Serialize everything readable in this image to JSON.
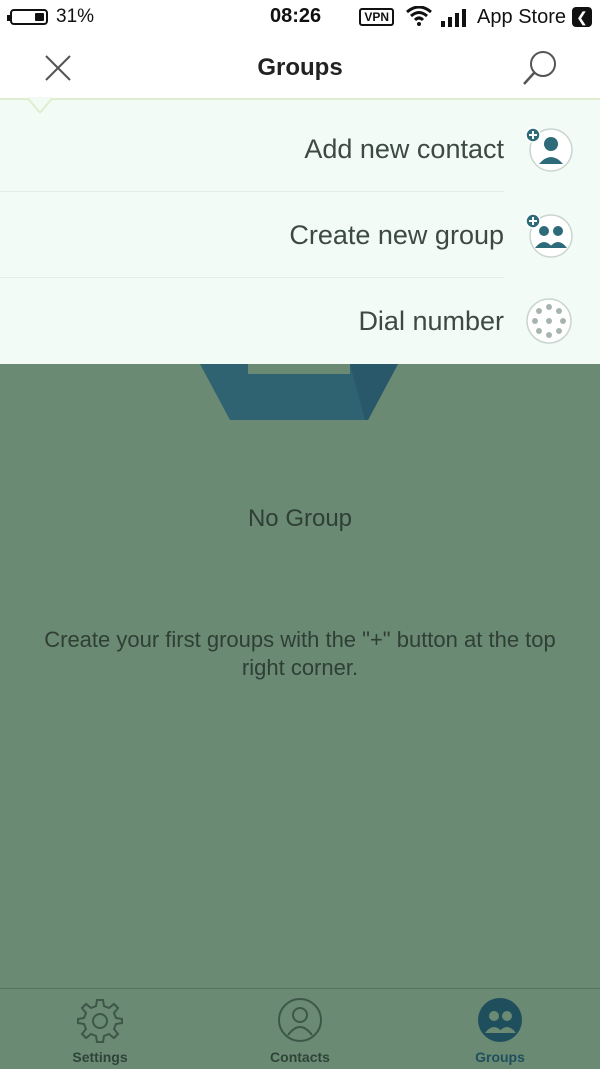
{
  "status_bar": {
    "back_app": "App Store",
    "vpn": "VPN",
    "time": "08:26",
    "battery_percent": "31%",
    "battery_level": 0.31
  },
  "nav": {
    "title": "Groups"
  },
  "menu": {
    "items": [
      {
        "label": "Add new contact",
        "icon": "add-contact-icon"
      },
      {
        "label": "Create new group",
        "icon": "add-group-icon"
      },
      {
        "label": "Dial number",
        "icon": "dial-pad-icon"
      }
    ]
  },
  "empty_state": {
    "title": "No Group",
    "description": "Create your first groups with the \"+\" button at the top right corner."
  },
  "tabs": [
    {
      "label": "Groups",
      "icon": "groups-icon",
      "active": true
    },
    {
      "label": "Contacts",
      "icon": "contacts-icon",
      "active": false
    },
    {
      "label": "Settings",
      "icon": "gear-icon",
      "active": false
    }
  ],
  "colors": {
    "accent": "#2e6b7a",
    "overlay": "#6a8a73",
    "menu_bg": "#f3fbf6",
    "tab_active": "#1f4f5c",
    "tab_inactive": "#3e5648"
  }
}
